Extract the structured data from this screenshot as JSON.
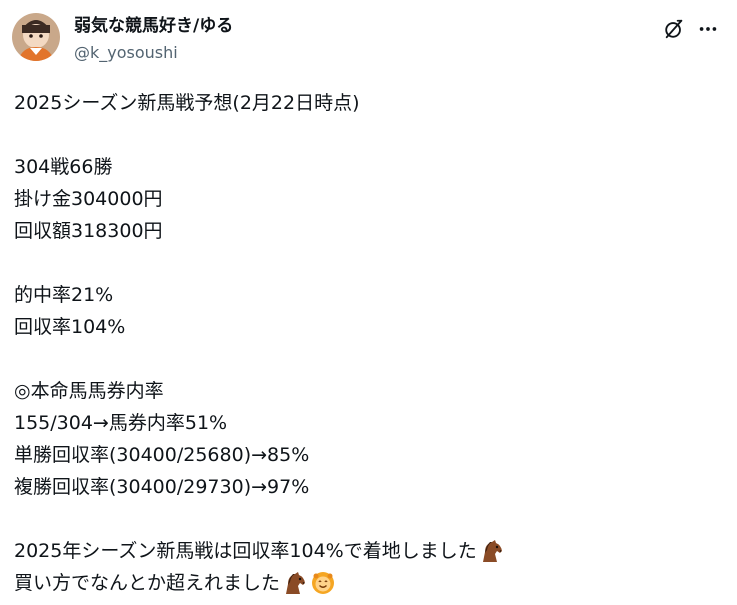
{
  "post": {
    "author": {
      "display_name": "弱気な競馬好き/ゆる",
      "handle": "@k_yosoushi",
      "avatar_icon": "avatar-image"
    },
    "header_actions": {
      "grok_icon": "grok-icon",
      "more_icon": "more-dots-icon"
    },
    "body_lines": [
      "2025シーズン新馬戦予想(2月22日時点)",
      "",
      "304戦66勝",
      "掛け金304000円",
      "回収額318300円",
      "",
      "的中率21%",
      "回収率104%",
      "",
      "◎本命馬馬券内率",
      "155/304→馬券内率51%",
      "単勝回収率(30400/25680)→85%",
      "複勝回収率(30400/29730)→97%",
      "",
      "2025年シーズン新馬戦は回収率104%で着地しました",
      "買い方でなんとか超えれました"
    ],
    "emojis": {
      "line_15": [
        "horse-emoji"
      ],
      "line_16": [
        "horse-emoji",
        "smiling-face-emoji"
      ]
    },
    "colors": {
      "text_primary": "#0f1419",
      "text_secondary": "#536471"
    }
  }
}
